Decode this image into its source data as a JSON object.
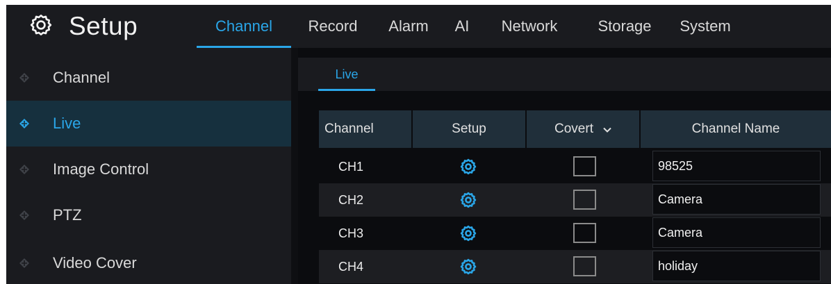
{
  "header": {
    "title": "Setup",
    "icon": "gear-icon",
    "tabs": [
      {
        "label": "Channel",
        "active": true
      },
      {
        "label": "Record",
        "active": false
      },
      {
        "label": "Alarm",
        "active": false
      },
      {
        "label": "AI",
        "active": false
      },
      {
        "label": "Network",
        "active": false
      },
      {
        "label": "Storage",
        "active": false
      },
      {
        "label": "System",
        "active": false
      }
    ]
  },
  "sidebar": {
    "items": [
      {
        "label": "Channel",
        "active": false
      },
      {
        "label": "Live",
        "active": true
      },
      {
        "label": "Image Control",
        "active": false
      },
      {
        "label": "PTZ",
        "active": false
      },
      {
        "label": "Video Cover",
        "active": false
      }
    ]
  },
  "content": {
    "sub_tab": "Live",
    "table": {
      "headers": {
        "channel": "Channel",
        "setup": "Setup",
        "covert": "Covert",
        "channel_name": "Channel Name"
      },
      "rows": [
        {
          "channel": "CH1",
          "covert": false,
          "name": "98525"
        },
        {
          "channel": "CH2",
          "covert": false,
          "name": "Camera"
        },
        {
          "channel": "CH3",
          "covert": false,
          "name": "Camera"
        },
        {
          "channel": "CH4",
          "covert": false,
          "name": "holiday"
        }
      ]
    }
  },
  "colors": {
    "accent": "#2aa6e8",
    "panel": "#1a1b1f",
    "background": "#0e0f12",
    "header_cell": "#202f3a"
  }
}
